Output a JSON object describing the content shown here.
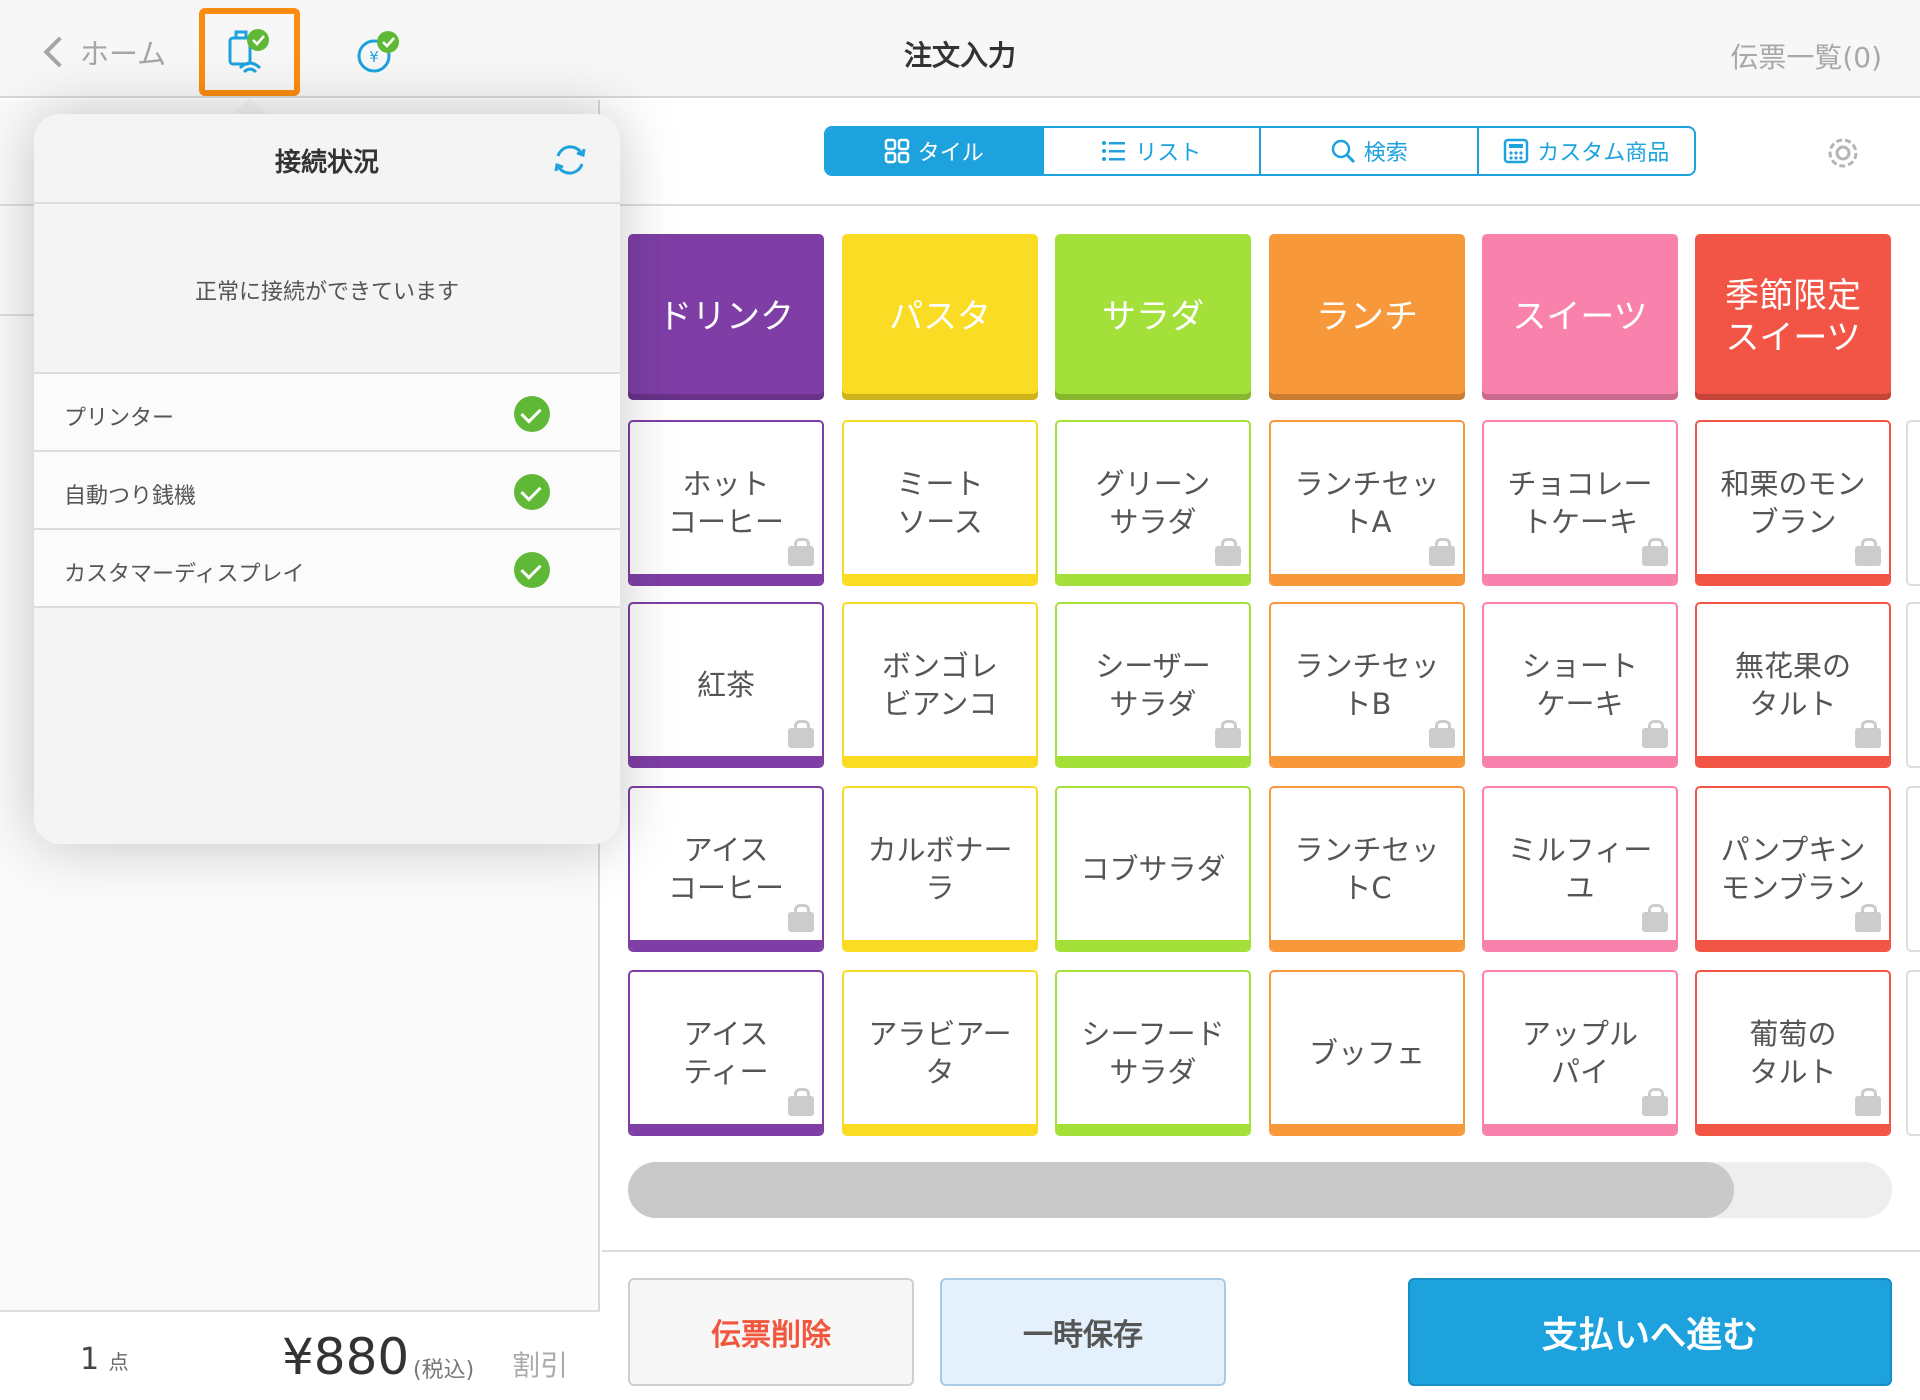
{
  "topbar": {
    "back_label": "ホーム",
    "title": "注文入力",
    "slip_list_label": "伝票一覧(0)",
    "icons": [
      "printer-connection-icon",
      "change-machine-icon"
    ]
  },
  "popover": {
    "title": "接続状況",
    "message": "正常に接続ができています",
    "devices": [
      {
        "label": "プリンター",
        "status": "connected"
      },
      {
        "label": "自動つり銭機",
        "status": "connected"
      },
      {
        "label": "カスタマーディスプレイ",
        "status": "connected"
      }
    ]
  },
  "view_tabs": [
    {
      "label": "タイル",
      "icon": "grid-icon",
      "active": true
    },
    {
      "label": "リスト",
      "icon": "list-icon",
      "active": false
    },
    {
      "label": "検索",
      "icon": "search-icon",
      "active": false
    },
    {
      "label": "カスタム商品",
      "icon": "calculator-icon",
      "active": false
    }
  ],
  "categories": [
    {
      "label": "ドリンク",
      "color": "#7e3ea6"
    },
    {
      "label": "パスタ",
      "color": "#fbdc24"
    },
    {
      "label": "サラダ",
      "color": "#a4e03a"
    },
    {
      "label": "ランチ",
      "color": "#f7993a"
    },
    {
      "label": "スイーツ",
      "color": "#f982ad"
    },
    {
      "label": "季節限定\nスイーツ",
      "color": "#f25546"
    }
  ],
  "items": [
    [
      "ホット\nコーヒー",
      "ミート\nソース",
      "グリーン\nサラダ",
      "ランチセッ\nトA",
      "チョコレー\nトケーキ",
      "和栗のモン\nブラン"
    ],
    [
      "紅茶",
      "ボンゴレ\nビアンコ",
      "シーザー\nサラダ",
      "ランチセッ\nトB",
      "ショート\nケーキ",
      "無花果の\nタルト"
    ],
    [
      "アイス\nコーヒー",
      "カルボナー\nラ",
      "コブサラダ",
      "ランチセッ\nトC",
      "ミルフィー\nユ",
      "パンプキン\nモンブラン"
    ],
    [
      "アイス\nティー",
      "アラビアー\nタ",
      "シーフード\nサラダ",
      "ブッフェ",
      "アップル\nパイ",
      "葡萄の\nタルト"
    ]
  ],
  "item_bag": [
    [
      true,
      false,
      true,
      true,
      true,
      true
    ],
    [
      true,
      false,
      true,
      true,
      true,
      true
    ],
    [
      true,
      false,
      false,
      false,
      true,
      true
    ],
    [
      true,
      false,
      false,
      false,
      true,
      true
    ]
  ],
  "scroll_fraction": 0.875,
  "summary": {
    "count": "1",
    "count_unit": "点",
    "total": "¥880",
    "tax_label": "(税込)",
    "discount_label": "割引"
  },
  "actions": {
    "delete_label": "伝票削除",
    "hold_label": "一時保存",
    "pay_label": "支払いへ進む"
  },
  "colors": {
    "accent": "#1da2de",
    "highlight": "#fb8c11",
    "ok": "#5fb936",
    "danger": "#f2573d"
  }
}
